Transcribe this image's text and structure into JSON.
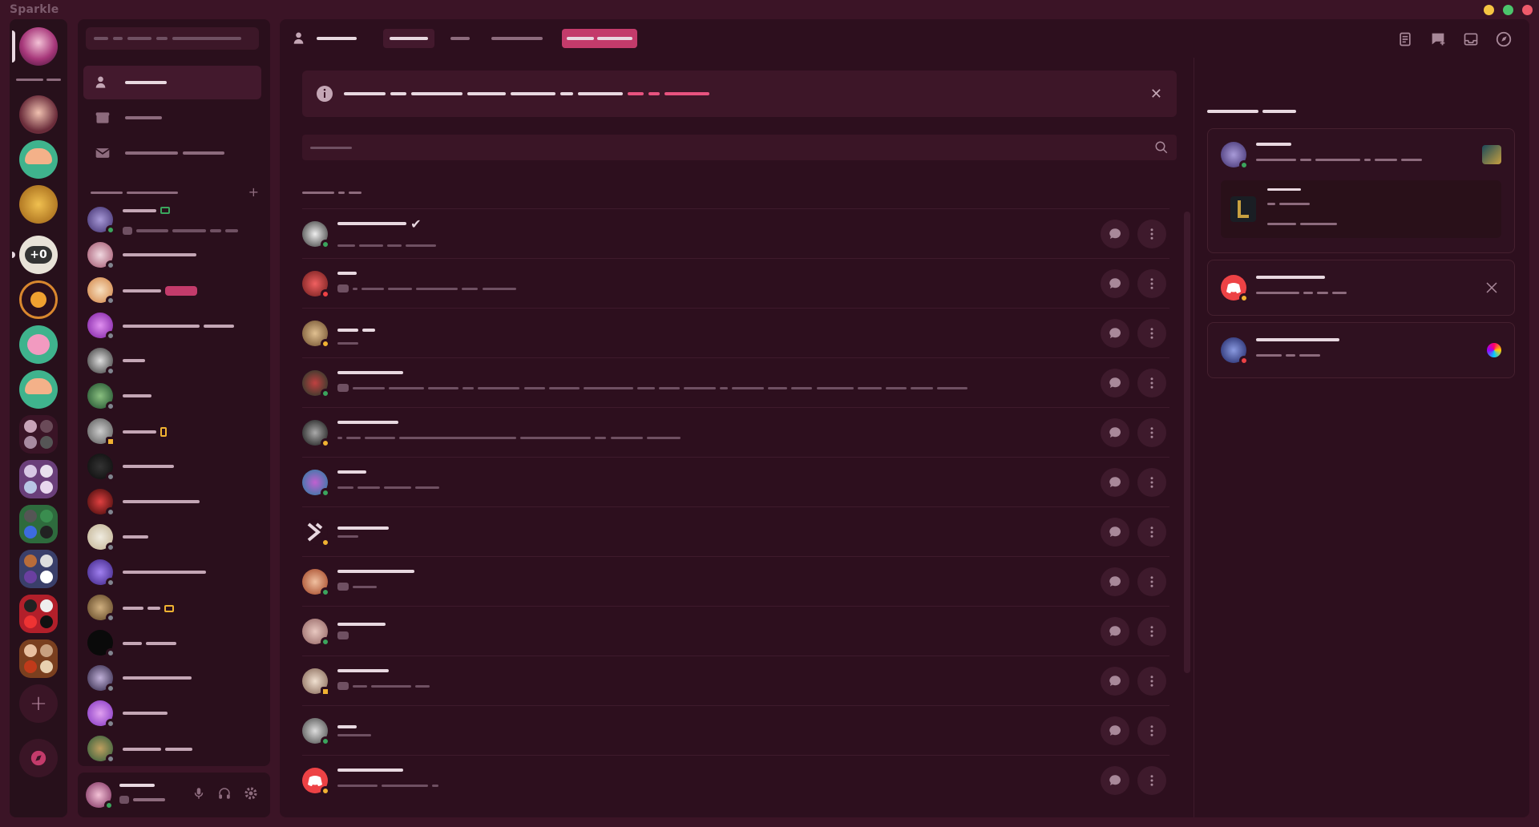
{
  "app": {
    "title": "Sparkle"
  },
  "colors": {
    "accent": "#c33b6b",
    "online": "#3ba55d",
    "idle": "#f0b232",
    "dnd": "#ed4245",
    "offline": "#80848e",
    "window_min": "#f5c542",
    "window_max": "#4cc46c",
    "window_close": "#ef5b6b"
  },
  "window_controls": [
    "minimize",
    "maximize",
    "close"
  ],
  "servers": [
    {
      "icon": "anime-avatar",
      "selected": true
    },
    {
      "icon": "anime-avatar"
    },
    {
      "icon": "mushroom-server-icon"
    },
    {
      "icon": "gold-server-icon"
    },
    {
      "icon": "plus-zero-server-icon",
      "label": "+0",
      "unread": true
    },
    {
      "icon": "circle-badge-server-icon"
    },
    {
      "icon": "pink-character-server-icon"
    },
    {
      "icon": "mushroom-server-icon"
    },
    {
      "icon": "folder-icon"
    },
    {
      "icon": "folder-icon"
    },
    {
      "icon": "folder-icon"
    },
    {
      "icon": "folder-icon"
    },
    {
      "icon": "folder-icon"
    },
    {
      "icon": "folder-icon"
    },
    {
      "icon": "add-server-icon",
      "label": "+"
    },
    {
      "icon": "discover-icon"
    }
  ],
  "sidebar": {
    "nav": [
      {
        "icon": "friends-icon",
        "active": true
      },
      {
        "icon": "nitro-shop-icon"
      },
      {
        "icon": "message-requests-icon"
      }
    ],
    "dm_add": "+",
    "dms": [
      {
        "status": "online"
      },
      {
        "status": "offline"
      },
      {
        "status": "offline"
      },
      {
        "status": "offline"
      },
      {
        "status": "offline"
      },
      {
        "status": "offline"
      },
      {
        "status": "offline"
      },
      {
        "status": "offline"
      },
      {
        "status": "offline"
      },
      {
        "status": "offline"
      },
      {
        "status": "offline"
      },
      {
        "status": "offline"
      },
      {
        "status": "offline"
      },
      {
        "status": "offline"
      },
      {
        "status": "offline"
      },
      {
        "status": "offline"
      }
    ]
  },
  "user_panel": {
    "status": "online",
    "icons": [
      "microphone-icon",
      "headphones-icon",
      "settings-icon"
    ]
  },
  "main": {
    "notice": {
      "close": "✕"
    },
    "friends": [
      {
        "status": "online",
        "verified": "✔"
      },
      {
        "status": "dnd"
      },
      {
        "status": "idle"
      },
      {
        "status": "online"
      },
      {
        "status": "idle"
      },
      {
        "status": "online"
      },
      {
        "status": "idle"
      },
      {
        "status": "online"
      },
      {
        "status": "online"
      },
      {
        "status": "idle"
      },
      {
        "status": "online"
      },
      {
        "status": "idle"
      }
    ]
  },
  "active_now": [
    {
      "status": "online",
      "game_icon": "league-of-legends-icon"
    },
    {
      "status": "idle",
      "game_icon": "app-icon"
    },
    {
      "status": "dnd",
      "game_icon": "color-wheel-icon"
    }
  ]
}
